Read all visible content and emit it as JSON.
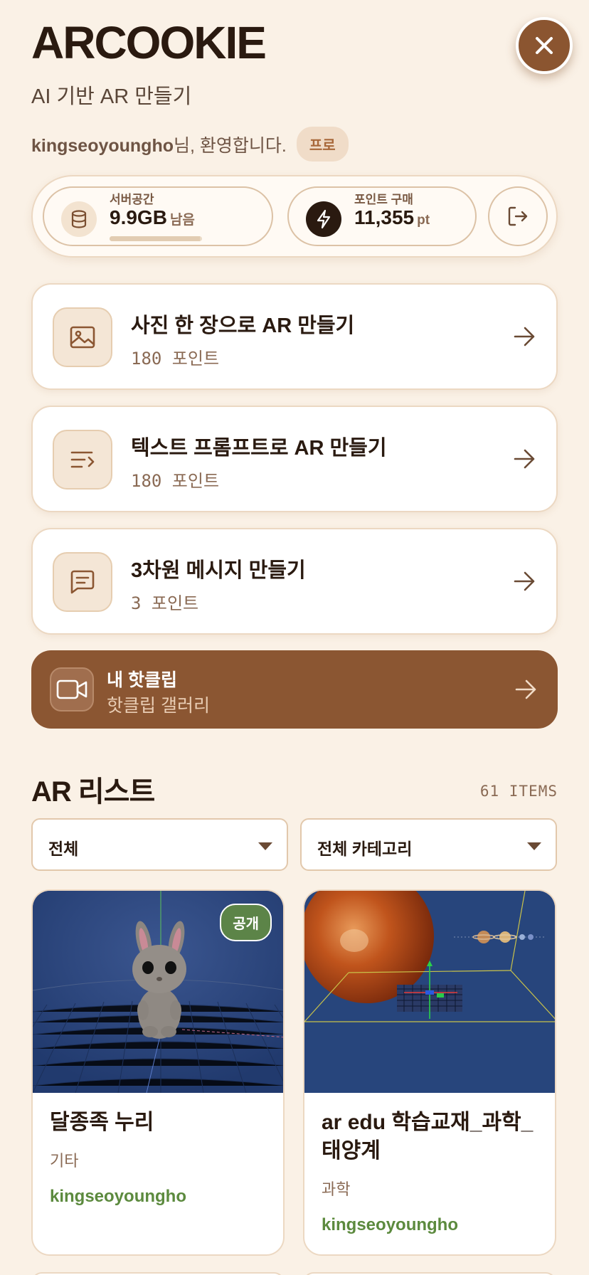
{
  "header": {
    "brand": "ARCOOKIE",
    "tagline": "AI 기반 AR 만들기",
    "username": "kingseoyoungho",
    "welcome_suffix": "님, 환영합니다.",
    "plan_badge": "프로",
    "close_icon": "close-icon"
  },
  "stats": {
    "storage": {
      "label": "서버공간",
      "value": "9.9GB",
      "unit": "남음",
      "icon": "database-icon",
      "usage_fraction": 0.98
    },
    "points": {
      "label": "포인트 구매",
      "value": "11,355",
      "unit": "pt",
      "icon": "lightning-icon"
    },
    "logout_icon": "logout-icon"
  },
  "actions": [
    {
      "title": "사진 한 장으로 AR 만들기",
      "subtitle": "180 포인트",
      "icon": "image-icon"
    },
    {
      "title": "텍스트 프롬프트로 AR 만들기",
      "subtitle": "180 포인트",
      "icon": "text-prompt-icon"
    },
    {
      "title": "3차원 메시지 만들기",
      "subtitle": "3 포인트",
      "icon": "message-icon"
    }
  ],
  "clips": {
    "title": "내 핫클립",
    "subtitle": "핫클립 갤러리",
    "icon": "video-icon"
  },
  "ar_list": {
    "title": "AR 리스트",
    "count": "61 ITEMS",
    "filter_value": "전체",
    "category_value": "전체 카테고리",
    "items": [
      {
        "title": "달종족 누리",
        "category": "기타",
        "author": "kingseoyoungho",
        "badge": "공개"
      },
      {
        "title": "ar edu 학습교재_과학_태양계",
        "category": "과학",
        "author": "kingseoyoungho",
        "badge": ""
      }
    ]
  },
  "colors": {
    "background": "#faf1e6",
    "accent_brown": "#8b5632",
    "public_badge": "#5c8448",
    "author_green": "#5c8a3e"
  }
}
